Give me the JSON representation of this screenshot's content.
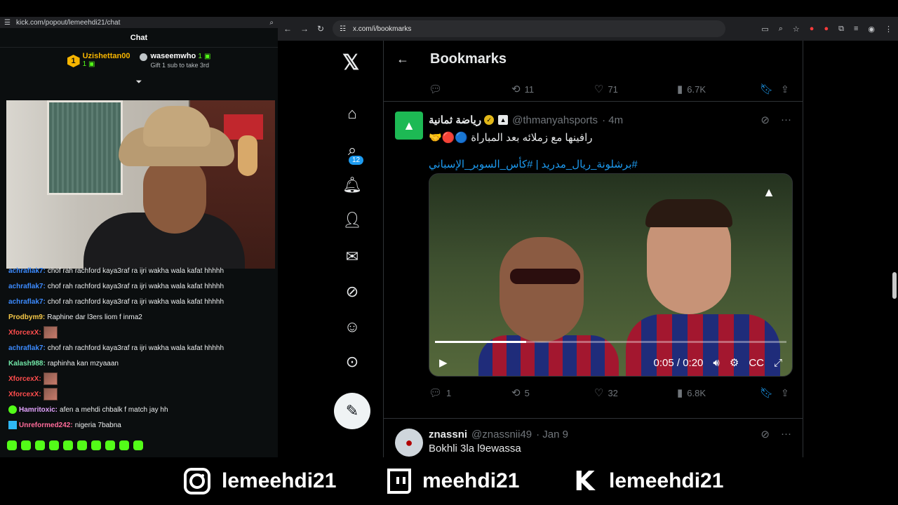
{
  "left_window": {
    "url": "kick.com/popout/lemeehdi21/chat",
    "chat_title": "Chat",
    "leaderboard": [
      {
        "rank": "1",
        "name": "Uzishettan00",
        "count": "1"
      },
      {
        "rank": "",
        "name": "waseemwho",
        "count": "1",
        "subtext": "Gift 1 sub to take 3rd"
      }
    ],
    "messages": [
      {
        "user": "achraflak7:",
        "text": "chof rah rachford kaya3raf ra ijri wakha wala kafat hhhhh",
        "color": "#3c8bff"
      },
      {
        "user": "achraflak7:",
        "text": "chof rah rachford kaya3raf ra ijri wakha wala kafat hhhhh",
        "color": "#3c8bff"
      },
      {
        "user": "achraflak7:",
        "text": "chof rah rachford kaya3raf ra ijri wakha wala kafat hhhhh",
        "color": "#3c8bff"
      },
      {
        "user": "Prodbym9:",
        "text": "Raphine dar l3ers liom f inma2",
        "color": "#f7c948"
      },
      {
        "user": "XforcexX:",
        "text": "",
        "color": "#ff4d4d",
        "emote": true
      },
      {
        "user": "achraflak7:",
        "text": "chof rah rachford kaya3raf ra ijri wakha wala kafat hhhhh",
        "color": "#3c8bff"
      },
      {
        "user": "Kalash988:",
        "text": "raphinha kan mzyaaan",
        "color": "#72e8a8"
      },
      {
        "user": "XforcexX:",
        "text": "",
        "color": "#ff4d4d",
        "emote": true
      },
      {
        "user": "XforcexX:",
        "text": "",
        "color": "#ff4d4d",
        "emote": true
      },
      {
        "user": "Hamritoxic:",
        "text": "afen a mehdi chbalk f match jay hh",
        "color": "#e3a4ff",
        "badge": "green"
      },
      {
        "user": "Unreformed242:",
        "text": "nigeria 7babna",
        "color": "#ff6b9a",
        "badge": "blue"
      }
    ]
  },
  "browser": {
    "url": "x.com/i/bookmarks",
    "notifications_count": "12"
  },
  "timeline": {
    "title": "Bookmarks",
    "top_actions": {
      "replies": "",
      "reposts": "11",
      "likes": "71",
      "views": "6.7K"
    },
    "tweet1": {
      "name": "رياضة ثمانية",
      "handle": "@thmanyahsports",
      "time": "· 4m",
      "text": "رافينها مع زملائه بعد المباراة 🔵🔴🤝",
      "hashtags": "#برشلونة_ريال_مدريد | #كأس_السوبر_الإسباني",
      "video": {
        "time": "0:05 / 0:20",
        "progress_percent": 26
      },
      "actions": {
        "replies": "1",
        "reposts": "5",
        "likes": "32",
        "views": "6.8K"
      }
    },
    "tweet2": {
      "name": "znassni",
      "handle": "@znassnii49",
      "time": "· Jan 9",
      "text": "Bokhli 3la l9ewassa"
    }
  },
  "banner": {
    "instagram": "lemeehdi21",
    "twitch": "meehdi21",
    "kick": "lemeehdi21"
  }
}
